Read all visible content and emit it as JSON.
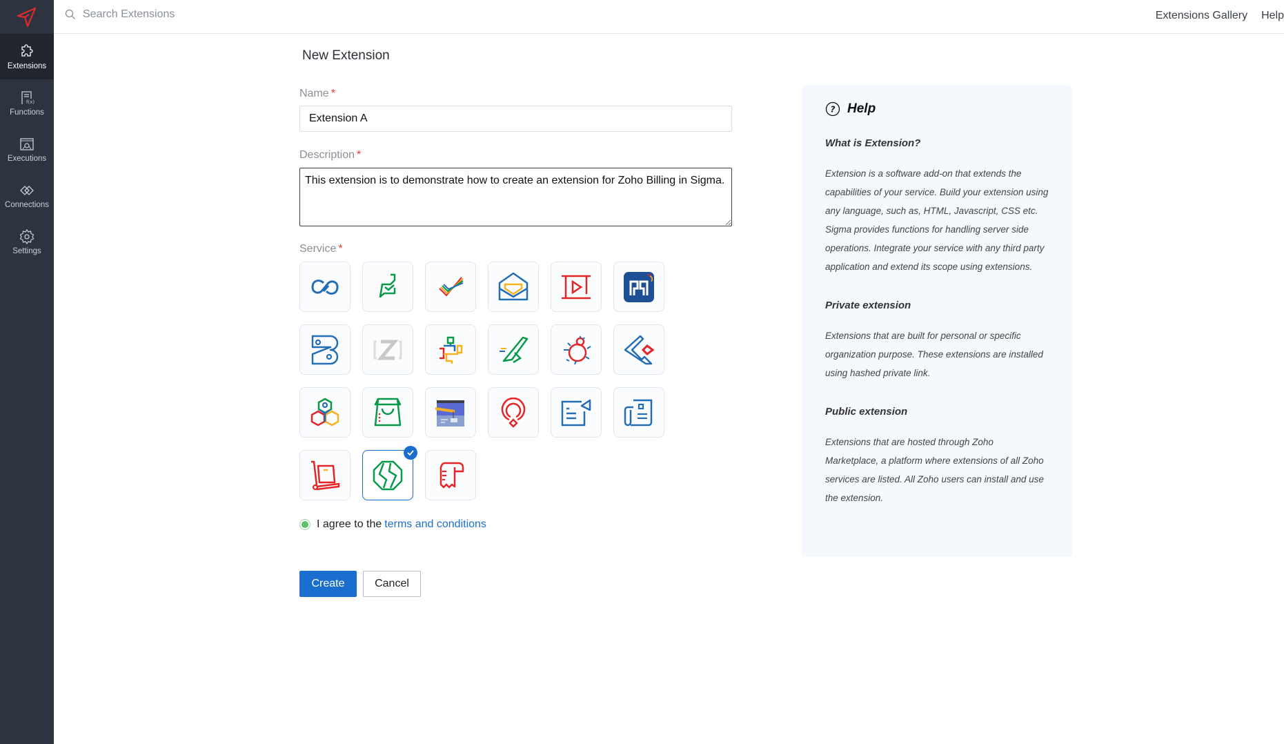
{
  "app": {
    "logo": "sigma-logo"
  },
  "sidebar": {
    "items": [
      {
        "label": "Extensions",
        "icon": "puzzle-icon",
        "active": true
      },
      {
        "label": "Functions",
        "icon": "function-icon",
        "active": false
      },
      {
        "label": "Executions",
        "icon": "executions-icon",
        "active": false
      },
      {
        "label": "Connections",
        "icon": "connections-icon",
        "active": false
      },
      {
        "label": "Settings",
        "icon": "gear-icon",
        "active": false
      }
    ]
  },
  "topbar": {
    "search_placeholder": "Search Extensions",
    "links": [
      "Extensions Gallery",
      "Help"
    ]
  },
  "form": {
    "title": "New Extension",
    "name_label": "Name",
    "name_value": "Extension A",
    "description_label": "Description",
    "description_value": "This extension is to demonstrate how to create an extension for Zoho Billing in Sigma.",
    "required_mark": "*",
    "service_label": "Service",
    "services": [
      {
        "name": "zoho-crm",
        "icon": "crm-infinity-icon",
        "color": "#226db4",
        "selected": false
      },
      {
        "name": "zoho-desk",
        "icon": "desk-chat-check-icon",
        "color": "#089949",
        "selected": false
      },
      {
        "name": "zoho-projects",
        "icon": "projects-check-icon",
        "color": "#e42527",
        "selected": false
      },
      {
        "name": "zoho-mail",
        "icon": "mail-envelope-icon",
        "color": "#226db4",
        "selected": false
      },
      {
        "name": "zoho-show",
        "icon": "show-play-icon",
        "color": "#e42527",
        "selected": false
      },
      {
        "name": "zoho-sprints",
        "icon": "sprints-app-icon",
        "color": "#1e4f95",
        "selected": false
      },
      {
        "name": "zoho-bookings",
        "icon": "bookings-icon",
        "color": "#226db4",
        "selected": false
      },
      {
        "name": "zoho-generic",
        "icon": "z-bracket-icon",
        "color": "#cccccc",
        "selected": false
      },
      {
        "name": "zoho-flow",
        "icon": "flow-puzzle-icon",
        "color": "#f9b21d",
        "selected": false
      },
      {
        "name": "zoho-expense",
        "icon": "expense-plane-icon",
        "color": "#089949",
        "selected": false
      },
      {
        "name": "zoho-bugtracker",
        "icon": "bug-icon",
        "color": "#e42527",
        "selected": false
      },
      {
        "name": "zoho-sign",
        "icon": "sign-diamond-icon",
        "color": "#226db4",
        "selected": false
      },
      {
        "name": "zoho-people",
        "icon": "people-hexagon-icon",
        "color": "#226db4",
        "selected": false
      },
      {
        "name": "zoho-commerce",
        "icon": "commerce-bag-icon",
        "color": "#089949",
        "selected": false
      },
      {
        "name": "zoho-sites",
        "icon": "sites-window-icon",
        "color": "#5b6bd6",
        "selected": false
      },
      {
        "name": "zoho-pagesense",
        "icon": "pagesense-pin-icon",
        "color": "#e42527",
        "selected": false
      },
      {
        "name": "zoho-campaigns",
        "icon": "campaigns-icon",
        "color": "#226db4",
        "selected": false
      },
      {
        "name": "zoho-books",
        "icon": "books-newspaper-icon",
        "color": "#226db4",
        "selected": false
      },
      {
        "name": "zoho-inventory",
        "icon": "inventory-trolley-icon",
        "color": "#e42527",
        "selected": false
      },
      {
        "name": "zoho-billing",
        "icon": "billing-globe-icon",
        "color": "#089949",
        "selected": true
      },
      {
        "name": "zoho-invoice",
        "icon": "invoice-receipt-icon",
        "color": "#e42527",
        "selected": false
      }
    ],
    "agree_text": "I agree to the",
    "terms_link": "terms and conditions",
    "agree_checked": true,
    "create_label": "Create",
    "cancel_label": "Cancel"
  },
  "help": {
    "title": "Help",
    "sections": [
      {
        "heading": "What is Extension?",
        "body": "Extension is a software add-on that extends the capabilities of your service. Build your extension using any language, such as, HTML, Javascript, CSS etc. Sigma provides functions for handling server side operations. Integrate your service with any third party application and extend its scope using extensions."
      },
      {
        "heading": "Private extension",
        "body": "Extensions that are built for personal or specific organization purpose. These extensions are installed using hashed private link."
      },
      {
        "heading": "Public extension",
        "body": "Extensions that are hosted through Zoho Marketplace, a platform where extensions of all Zoho services are listed. All Zoho users can install and use the extension."
      }
    ]
  },
  "colors": {
    "sidebar_bg": "#2d3440",
    "sidebar_active": "#20252e",
    "accent": "#1a6fce",
    "help_bg": "#f5f9fd",
    "required": "#e53935",
    "radio_checked": "#5cc36a"
  }
}
